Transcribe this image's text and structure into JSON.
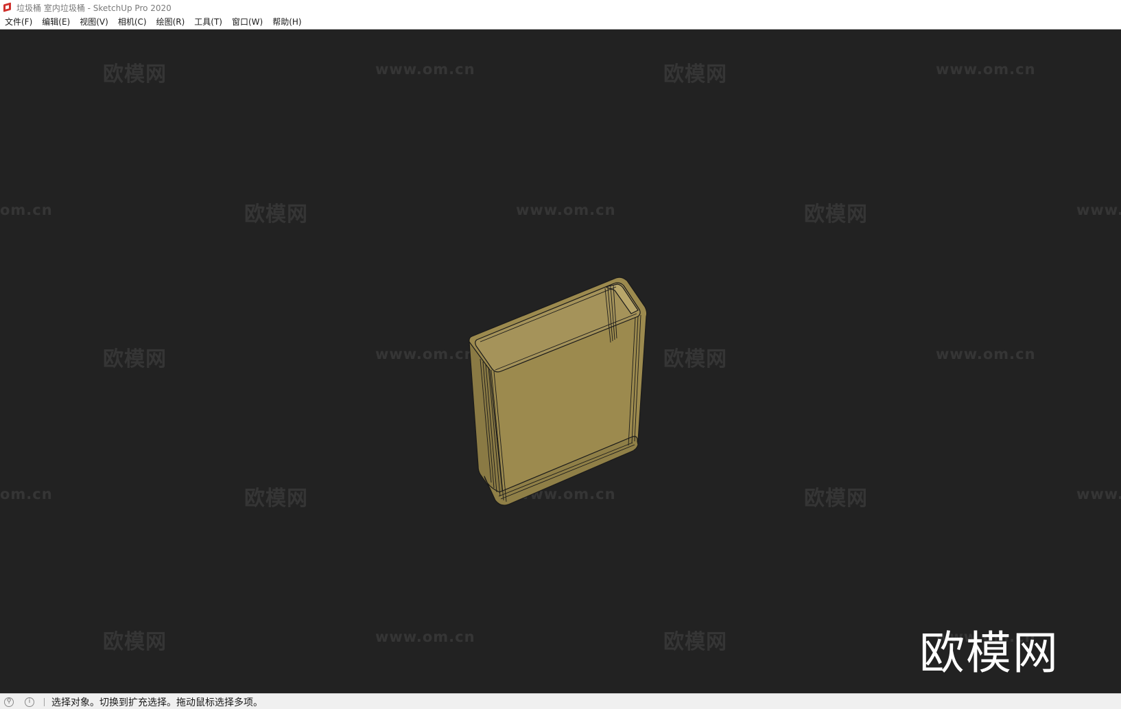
{
  "window": {
    "title": "垃圾桶 室内垃圾桶 - SketchUp Pro 2020",
    "app_icon": "sketchup-logo-icon"
  },
  "menubar": {
    "items": [
      {
        "label": "文件(F)"
      },
      {
        "label": "编辑(E)"
      },
      {
        "label": "视图(V)"
      },
      {
        "label": "相机(C)"
      },
      {
        "label": "绘图(R)"
      },
      {
        "label": "工具(T)"
      },
      {
        "label": "窗口(W)"
      },
      {
        "label": "帮助(H)"
      }
    ]
  },
  "viewport": {
    "background": "#222222",
    "model_color": "#9c8a4e",
    "model_edge_color": "#1a1a1a",
    "watermarks": {
      "cn": "欧模网",
      "en": "www.om.cn",
      "partial_en_left": "om.cn",
      "partial_en_right": "www."
    },
    "logo": "欧模网"
  },
  "statusbar": {
    "icons": [
      "geolocation-icon",
      "info-icon"
    ],
    "message": "选择对象。切换到扩充选择。拖动鼠标选择多项。"
  }
}
